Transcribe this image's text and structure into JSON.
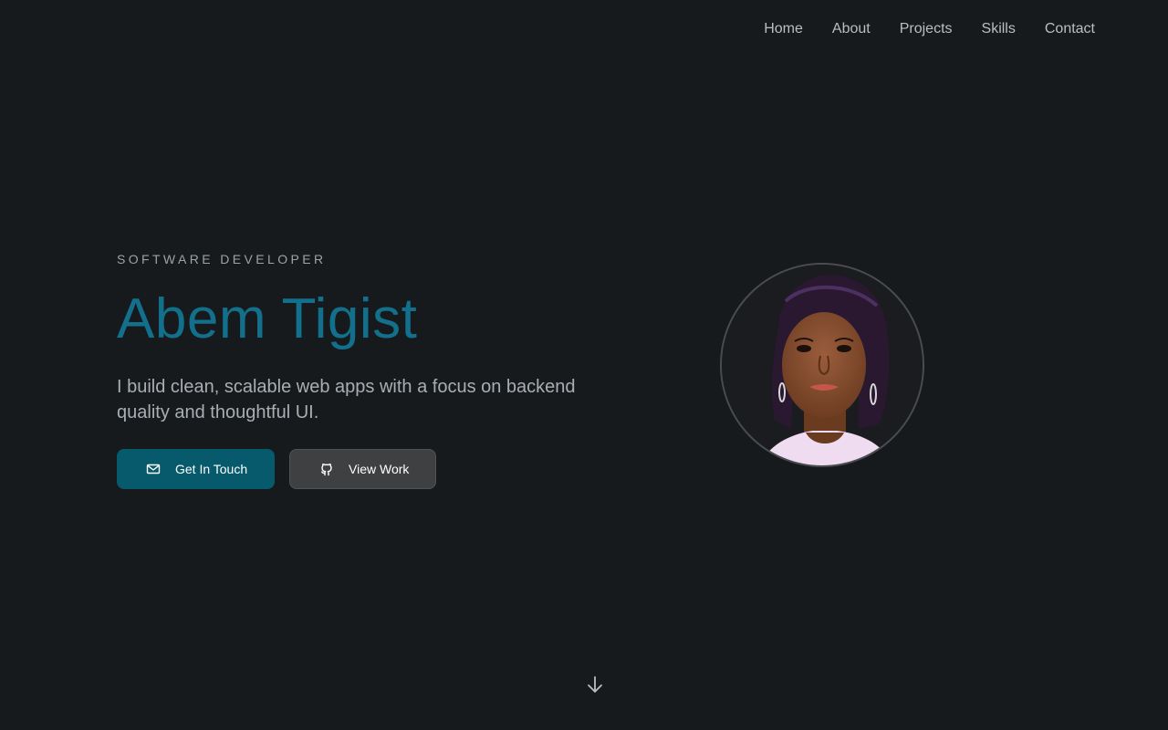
{
  "nav": {
    "items": [
      "Home",
      "About",
      "Projects",
      "Skills",
      "Contact"
    ]
  },
  "hero": {
    "role": "Software Developer",
    "name": "Abem Tigist",
    "tagline": "I build clean, scalable web apps with a focus on backend quality and thoughtful UI.",
    "primary_button": "Get In Touch",
    "secondary_button": "View Work",
    "primary_icon": "mail-icon",
    "secondary_icon": "github-icon"
  },
  "scroll_icon": "arrow-down-icon",
  "colors": {
    "background": "#171a1c",
    "accent": "#13708c",
    "primary_button": "#065a6b",
    "secondary_button": "#3f4042"
  }
}
